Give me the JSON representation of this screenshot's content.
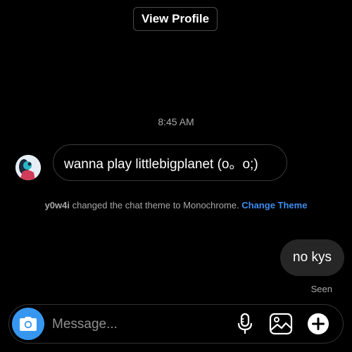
{
  "header": {
    "view_profile_label": "View Profile"
  },
  "conversation": {
    "timestamp": "8:45 AM",
    "incoming_message": "wanna play littlebigplanet (o。o;)",
    "system_notice": {
      "username": "y0w4i",
      "text": " changed the chat theme to Monochrome. ",
      "action_label": "Change Theme"
    },
    "outgoing_message": "no kys",
    "read_status": "Seen"
  },
  "composer": {
    "placeholder": "Message...",
    "icons": [
      "camera-icon",
      "microphone-icon",
      "gallery-icon",
      "add-icon"
    ]
  },
  "colors": {
    "background": "#000000",
    "accent": "#3797f0",
    "link": "#3d8ef0",
    "outgoing_bubble": "#262626",
    "muted_text": "#a8a8a8"
  }
}
